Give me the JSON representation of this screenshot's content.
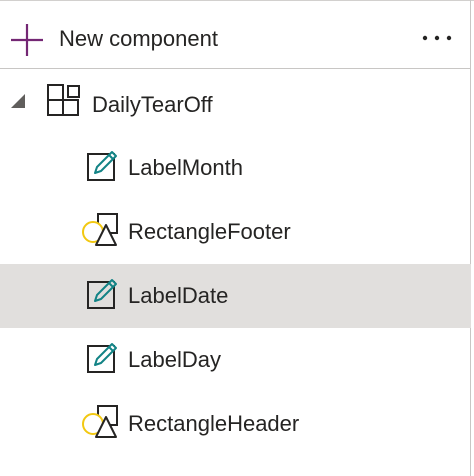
{
  "header": {
    "new_component_label": "New component",
    "plus_icon": "plus-icon",
    "more_icon": "more-horizontal-icon"
  },
  "tree": {
    "root": {
      "label": "DailyTearOff",
      "icon": "component-icon",
      "expanded": true
    },
    "children": [
      {
        "label": "LabelMonth",
        "icon": "label-icon",
        "selected": false
      },
      {
        "label": "RectangleFooter",
        "icon": "shapes-icon",
        "selected": false
      },
      {
        "label": "LabelDate",
        "icon": "label-icon",
        "selected": true
      },
      {
        "label": "LabelDay",
        "icon": "label-icon",
        "selected": false
      },
      {
        "label": "RectangleHeader",
        "icon": "shapes-icon",
        "selected": false
      }
    ]
  },
  "colors": {
    "accent_purple": "#742774",
    "label_icon_teal": "#128385",
    "shape_circle_yellow": "#f2c811",
    "selected_row": "#e1dfdd",
    "text": "#252423"
  }
}
